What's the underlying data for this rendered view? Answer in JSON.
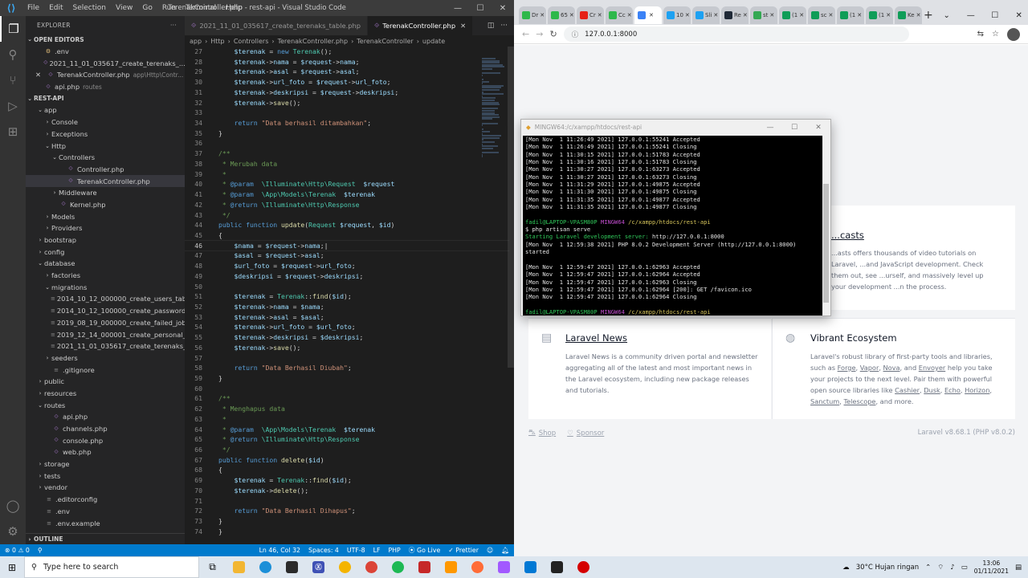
{
  "vscode": {
    "title": "TerenakController.php - rest-api - Visual Studio Code",
    "menu": [
      "File",
      "Edit",
      "Selection",
      "View",
      "Go",
      "Run",
      "Terminal",
      "Help"
    ],
    "explorer": {
      "header": "EXPLORER",
      "open_editors_label": "OPEN EDITORS",
      "open_editors": [
        {
          "icon": "⚙",
          "name": ".env",
          "sub": ""
        },
        {
          "icon": "php",
          "name": "2021_11_01_035617_create_terenaks_...",
          "sub": ""
        },
        {
          "icon": "php",
          "name": "TerenakController.php",
          "sub": "app\\Http\\Contr..."
        },
        {
          "icon": "php",
          "name": "api.php",
          "sub": "routes"
        }
      ],
      "project_label": "REST-API",
      "tree": [
        {
          "indent": 1,
          "chev": "⌄",
          "name": "app",
          "folder": true
        },
        {
          "indent": 2,
          "chev": "›",
          "name": "Console",
          "folder": true
        },
        {
          "indent": 2,
          "chev": "›",
          "name": "Exceptions",
          "folder": true
        },
        {
          "indent": 2,
          "chev": "⌄",
          "name": "Http",
          "folder": true
        },
        {
          "indent": 3,
          "chev": "⌄",
          "name": "Controllers",
          "folder": true
        },
        {
          "indent": 4,
          "chev": "",
          "name": "Controller.php",
          "folder": false
        },
        {
          "indent": 4,
          "chev": "",
          "name": "TerenakController.php",
          "folder": false,
          "selected": true
        },
        {
          "indent": 3,
          "chev": "›",
          "name": "Middleware",
          "folder": true
        },
        {
          "indent": 3,
          "chev": "",
          "name": "Kernel.php",
          "folder": false
        },
        {
          "indent": 2,
          "chev": "›",
          "name": "Models",
          "folder": true
        },
        {
          "indent": 2,
          "chev": "›",
          "name": "Providers",
          "folder": true
        },
        {
          "indent": 1,
          "chev": "›",
          "name": "bootstrap",
          "folder": true
        },
        {
          "indent": 1,
          "chev": "›",
          "name": "config",
          "folder": true
        },
        {
          "indent": 1,
          "chev": "⌄",
          "name": "database",
          "folder": true
        },
        {
          "indent": 2,
          "chev": "›",
          "name": "factories",
          "folder": true
        },
        {
          "indent": 2,
          "chev": "⌄",
          "name": "migrations",
          "folder": true
        },
        {
          "indent": 3,
          "chev": "",
          "name": "2014_10_12_000000_create_users_table....",
          "folder": false
        },
        {
          "indent": 3,
          "chev": "",
          "name": "2014_10_12_100000_create_password_re...",
          "folder": false
        },
        {
          "indent": 3,
          "chev": "",
          "name": "2019_08_19_000000_create_failed_jobs_t...",
          "folder": false
        },
        {
          "indent": 3,
          "chev": "",
          "name": "2019_12_14_000001_create_personal_ac...",
          "folder": false
        },
        {
          "indent": 3,
          "chev": "",
          "name": "2021_11_01_035617_create_terenaks_ta...",
          "folder": false
        },
        {
          "indent": 2,
          "chev": "›",
          "name": "seeders",
          "folder": true
        },
        {
          "indent": 2,
          "chev": "",
          "name": ".gitignore",
          "folder": false
        },
        {
          "indent": 1,
          "chev": "›",
          "name": "public",
          "folder": true
        },
        {
          "indent": 1,
          "chev": "›",
          "name": "resources",
          "folder": true
        },
        {
          "indent": 1,
          "chev": "⌄",
          "name": "routes",
          "folder": true
        },
        {
          "indent": 2,
          "chev": "",
          "name": "api.php",
          "folder": false
        },
        {
          "indent": 2,
          "chev": "",
          "name": "channels.php",
          "folder": false
        },
        {
          "indent": 2,
          "chev": "",
          "name": "console.php",
          "folder": false
        },
        {
          "indent": 2,
          "chev": "",
          "name": "web.php",
          "folder": false
        },
        {
          "indent": 1,
          "chev": "›",
          "name": "storage",
          "folder": true
        },
        {
          "indent": 1,
          "chev": "›",
          "name": "tests",
          "folder": true
        },
        {
          "indent": 1,
          "chev": "›",
          "name": "vendor",
          "folder": true
        },
        {
          "indent": 1,
          "chev": "",
          "name": ".editorconfig",
          "folder": false
        },
        {
          "indent": 1,
          "chev": "",
          "name": ".env",
          "folder": false
        },
        {
          "indent": 1,
          "chev": "",
          "name": ".env.example",
          "folder": false
        }
      ],
      "outline_label": "OUTLINE"
    },
    "tabs": [
      {
        "label": "2021_11_01_035617_create_terenaks_table.php",
        "active": false
      },
      {
        "label": "TerenakController.php",
        "active": true
      }
    ],
    "breadcrumb": [
      "app",
      "›",
      "Http",
      "›",
      "Controllers",
      "›",
      "TerenakController.php",
      "›",
      "TerenakController",
      "›",
      "update"
    ],
    "code_lines": [
      {
        "n": "27",
        "html": "    <span class='v'>$terenak</span> = <span class='k'>new</span> <span class='t'>Terenak</span>();"
      },
      {
        "n": "28",
        "html": "    <span class='v'>$terenak</span>-><span class='v'>nama</span> = <span class='v'>$request</span>-><span class='v'>nama</span>;"
      },
      {
        "n": "29",
        "html": "    <span class='v'>$terenak</span>-><span class='v'>asal</span> = <span class='v'>$request</span>-><span class='v'>asal</span>;"
      },
      {
        "n": "30",
        "html": "    <span class='v'>$terenak</span>-><span class='v'>url_foto</span> = <span class='v'>$request</span>-><span class='v'>url_foto</span>;"
      },
      {
        "n": "31",
        "html": "    <span class='v'>$terenak</span>-><span class='v'>deskripsi</span> = <span class='v'>$request</span>-><span class='v'>deskripsi</span>;"
      },
      {
        "n": "32",
        "html": "    <span class='v'>$terenak</span>-><span class='f'>save</span>();"
      },
      {
        "n": "33",
        "html": ""
      },
      {
        "n": "34",
        "html": "    <span class='k'>return</span> <span class='s'>\"Data berhasil ditambahkan\"</span>;"
      },
      {
        "n": "35",
        "html": "}"
      },
      {
        "n": "36",
        "html": ""
      },
      {
        "n": "37",
        "html": "<span class='c'>/**</span>"
      },
      {
        "n": "38",
        "html": "<span class='c'> * Merubah data</span>"
      },
      {
        "n": "39",
        "html": "<span class='c'> *</span>"
      },
      {
        "n": "40",
        "html": "<span class='c'> * </span><span class='k'>@param</span><span class='c'>  </span><span class='t'>\\Illuminate\\Http\\Request</span><span class='c'>  </span><span class='v'>$request</span>"
      },
      {
        "n": "41",
        "html": "<span class='c'> * </span><span class='k'>@param</span><span class='c'>  </span><span class='t'>\\App\\Models\\Terenak</span><span class='c'>  </span><span class='v'>$terenak</span>"
      },
      {
        "n": "42",
        "html": "<span class='c'> * </span><span class='k'>@return</span><span class='c'> </span><span class='t'>\\Illuminate\\Http\\Response</span>"
      },
      {
        "n": "43",
        "html": "<span class='c'> */</span>"
      },
      {
        "n": "44",
        "html": "<span class='k'>public</span> <span class='k'>function</span> <span class='f'>update</span>(<span class='t'>Request</span> <span class='v'>$request</span>, <span class='v'>$id</span>)"
      },
      {
        "n": "45",
        "html": "{"
      },
      {
        "n": "46",
        "html": "    <span class='v'>$nama</span> = <span class='v'>$request</span>-><span class='v'>nama</span>;|",
        "cur": true
      },
      {
        "n": "47",
        "html": "    <span class='v'>$asal</span> = <span class='v'>$request</span>-><span class='v'>asal</span>;"
      },
      {
        "n": "48",
        "html": "    <span class='v'>$url_foto</span> = <span class='v'>$request</span>-><span class='v'>url_foto</span>;"
      },
      {
        "n": "49",
        "html": "    <span class='v'>$deskripsi</span> = <span class='v'>$request</span>-><span class='v'>deskripsi</span>;"
      },
      {
        "n": "50",
        "html": ""
      },
      {
        "n": "51",
        "html": "    <span class='v'>$terenak</span> = <span class='t'>Terenak</span>::<span class='f'>find</span>(<span class='v'>$id</span>);"
      },
      {
        "n": "52",
        "html": "    <span class='v'>$terenak</span>-><span class='v'>nama</span> = <span class='v'>$nama</span>;"
      },
      {
        "n": "53",
        "html": "    <span class='v'>$terenak</span>-><span class='v'>asal</span> = <span class='v'>$asal</span>;"
      },
      {
        "n": "54",
        "html": "    <span class='v'>$terenak</span>-><span class='v'>url_foto</span> = <span class='v'>$url_foto</span>;"
      },
      {
        "n": "55",
        "html": "    <span class='v'>$terenak</span>-><span class='v'>deskripsi</span> = <span class='v'>$deskripsi</span>;"
      },
      {
        "n": "56",
        "html": "    <span class='v'>$terenak</span>-><span class='f'>save</span>();"
      },
      {
        "n": "57",
        "html": ""
      },
      {
        "n": "58",
        "html": "    <span class='k'>return</span> <span class='s'>\"Data Berhasil Diubah\"</span>;"
      },
      {
        "n": "59",
        "html": "}"
      },
      {
        "n": "60",
        "html": ""
      },
      {
        "n": "61",
        "html": "<span class='c'>/**</span>"
      },
      {
        "n": "62",
        "html": "<span class='c'> * Menghapus data</span>"
      },
      {
        "n": "63",
        "html": "<span class='c'> *</span>"
      },
      {
        "n": "64",
        "html": "<span class='c'> * </span><span class='k'>@param</span><span class='c'>  </span><span class='t'>\\App\\Models\\Terenak</span><span class='c'>  </span><span class='v'>$terenak</span>"
      },
      {
        "n": "65",
        "html": "<span class='c'> * </span><span class='k'>@return</span><span class='c'> </span><span class='t'>\\Illuminate\\Http\\Response</span>"
      },
      {
        "n": "66",
        "html": "<span class='c'> */</span>"
      },
      {
        "n": "67",
        "html": "<span class='k'>public</span> <span class='k'>function</span> <span class='f'>delete</span>(<span class='v'>$id</span>)"
      },
      {
        "n": "68",
        "html": "{"
      },
      {
        "n": "69",
        "html": "    <span class='v'>$terenak</span> = <span class='t'>Terenak</span>::<span class='f'>find</span>(<span class='v'>$id</span>);"
      },
      {
        "n": "70",
        "html": "    <span class='v'>$terenak</span>-><span class='f'>delete</span>();"
      },
      {
        "n": "71",
        "html": ""
      },
      {
        "n": "72",
        "html": "    <span class='k'>return</span> <span class='s'>\"Data Berhasil Dihapus\"</span>;"
      },
      {
        "n": "73",
        "html": "}"
      },
      {
        "n": "74",
        "html": "}"
      }
    ],
    "status": {
      "errors": "⊗ 0 ⚠ 0",
      "branch": "⚲",
      "position": "Ln 46, Col 32",
      "spaces": "Spaces: 4",
      "encoding": "UTF-8",
      "eol": "LF",
      "lang": "PHP",
      "golive": "⦿ Go Live",
      "prettier": "✓ Prettier"
    }
  },
  "browser": {
    "tabs": [
      {
        "label": "Dr",
        "color": "#2eb84b"
      },
      {
        "label": "65",
        "color": "#2eb84b"
      },
      {
        "label": "Cr",
        "color": "#e62117"
      },
      {
        "label": "Cc",
        "color": "#2eb84b"
      },
      {
        "label": "",
        "color": "#3b82f6",
        "active": true
      },
      {
        "label": "10",
        "color": "#1da1f2"
      },
      {
        "label": "Sli",
        "color": "#1da1f2"
      },
      {
        "label": "Re",
        "color": "#1f2937"
      },
      {
        "label": "st",
        "color": "#34a853"
      },
      {
        "label": "(1",
        "color": "#0f9d58"
      },
      {
        "label": "sc",
        "color": "#0f9d58"
      },
      {
        "label": "(1",
        "color": "#0f9d58"
      },
      {
        "label": "(1",
        "color": "#0f9d58"
      },
      {
        "label": "Ke",
        "color": "#0f9d58"
      }
    ],
    "url": "127.0.0.1:8000",
    "cards": {
      "laracasts": {
        "title": "...casts",
        "body": "...asts offers thousands of video tutorials on Laravel, ...and JavaScript development. Check them out, see ...urself, and massively level up your development ...n the process."
      },
      "news": {
        "title": "Laravel News",
        "body": "Laravel News is a community driven portal and newsletter aggregating all of the latest and most important news in the Laravel ecosystem, including new package releases and tutorials."
      },
      "ecosystem": {
        "title": "Vibrant Ecosystem",
        "body_pre": "Laravel's robust library of first-party tools and libraries, such as",
        "links1": [
          "Forge",
          "Vapor",
          "Nova"
        ],
        "and1": "and",
        "link_envoyer": "Envoyer",
        "body_mid": "help you take your projects to the next level. Pair them with powerful open source libraries like",
        "links2": [
          "Cashier",
          "Dusk",
          "Echo",
          "Horizon",
          "Sanctum",
          "Telescope"
        ],
        "body_end": ", and more."
      }
    },
    "footer": {
      "shop": "Shop",
      "sponsor": "Sponsor",
      "version": "Laravel v8.68.1 (PHP v8.0.2)"
    }
  },
  "terminal": {
    "title": "MINGW64:/c/xampp/htdocs/rest-api",
    "lines": [
      "[Mon Nov  1 11:26:49 2021] 127.0.0.1:55241 Accepted",
      "[Mon Nov  1 11:26:49 2021] 127.0.0.1:55241 Closing",
      "[Mon Nov  1 11:30:15 2021] 127.0.0.1:51783 Accepted",
      "[Mon Nov  1 11:30:16 2021] 127.0.0.1:51783 Closing",
      "[Mon Nov  1 11:30:27 2021] 127.0.0.1:63273 Accepted",
      "[Mon Nov  1 11:30:27 2021] 127.0.0.1:63273 Closing",
      "[Mon Nov  1 11:31:29 2021] 127.0.0.1:49875 Accepted",
      "[Mon Nov  1 11:31:30 2021] 127.0.0.1:49875 Closing",
      "[Mon Nov  1 11:31:35 2021] 127.0.0.1:49877 Accepted",
      "[Mon Nov  1 11:31:35 2021] 127.0.0.1:49877 Closing",
      "",
      "__PROMPT__",
      "$ php artisan serve",
      "__STARTING__",
      "[Mon Nov  1 12:59:38 2021] PHP 8.0.2 Development Server (http://127.0.0.1:8000)",
      "started",
      "",
      "[Mon Nov  1 12:59:47 2021] 127.0.0.1:62963 Accepted",
      "[Mon Nov  1 12:59:47 2021] 127.0.0.1:62964 Accepted",
      "[Mon Nov  1 12:59:47 2021] 127.0.0.1:62963 Closing",
      "[Mon Nov  1 12:59:47 2021] 127.0.0.1:62964 [200]: GET /favicon.ico",
      "[Mon Nov  1 12:59:47 2021] 127.0.0.1:62964 Closing",
      "",
      "__PROMPT__",
      "$ |"
    ],
    "prompt_user": "fadil@LAPTOP-VPASM80P",
    "prompt_env": "MINGW64",
    "prompt_path": "/c/xampp/htdocs/rest-api",
    "starting_text": "Starting Laravel development server:",
    "starting_url": "http://127.0.0.1:8000"
  },
  "taskbar": {
    "search_placeholder": "Type here to search",
    "weather": "30°C  Hujan ringan",
    "time": "13:06",
    "date": "01/11/2021"
  }
}
